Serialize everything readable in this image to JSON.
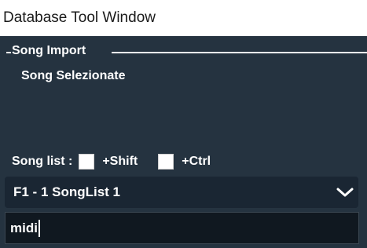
{
  "window": {
    "title": "Database Tool Window"
  },
  "group": {
    "title": "Song Import",
    "selected_label": "Song Selezionate"
  },
  "options": {
    "song_list_label": "Song list :",
    "shift_label": "+Shift",
    "ctrl_label": "+Ctrl",
    "shift_checked": false,
    "ctrl_checked": false
  },
  "songlist_dropdown": {
    "selected": "F1 - 1 SongList 1"
  },
  "search_field": {
    "value": "midi"
  },
  "colors": {
    "panel_bg": "#253340",
    "dropdown_bg": "#1a2633",
    "field_bg": "#101820",
    "text": "#ffffff"
  }
}
